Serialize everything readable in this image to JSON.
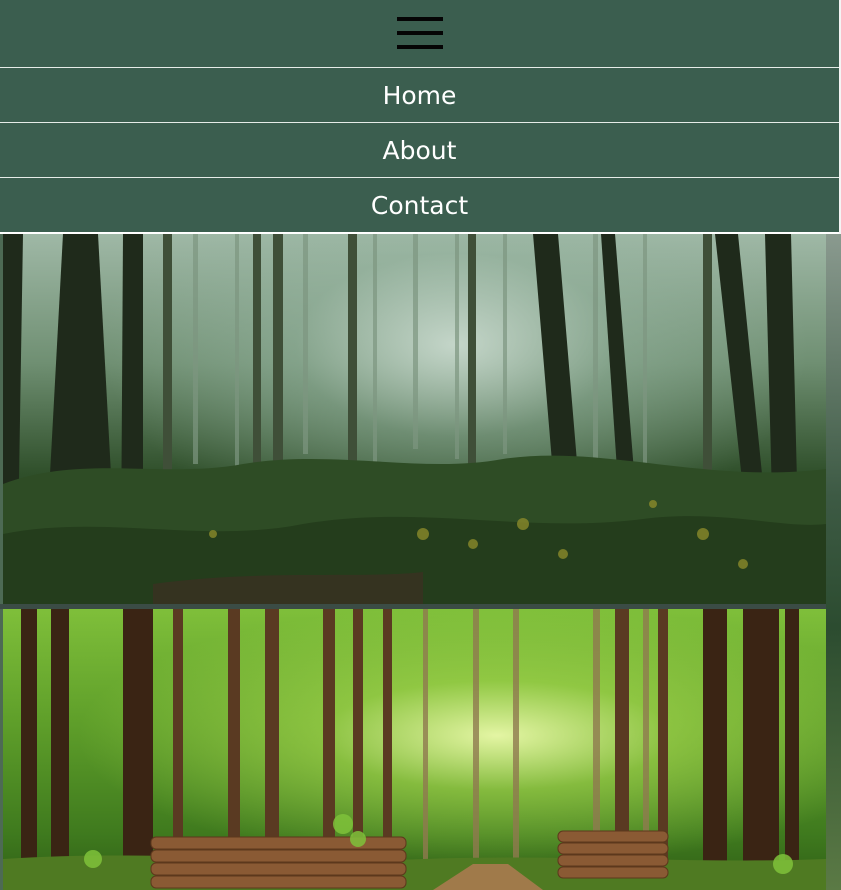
{
  "nav": {
    "toggle_icon": "hamburger-menu-icon",
    "items": [
      {
        "label": "Home"
      },
      {
        "label": "About"
      },
      {
        "label": "Contact"
      }
    ]
  },
  "slides": [
    {
      "image": "misty-forest-photo"
    },
    {
      "image": "sunlit-forest-path-with-log-piles-photo"
    }
  ],
  "colors": {
    "nav_background": "#3b5e4f",
    "nav_text": "#ffffff",
    "icon": "#050505"
  }
}
